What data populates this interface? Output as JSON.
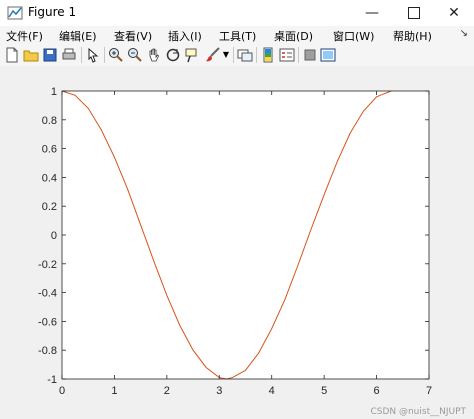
{
  "window": {
    "title": "Figure 1"
  },
  "menu": {
    "items": [
      "文件(F)",
      "编辑(E)",
      "查看(V)",
      "插入(I)",
      "工具(T)",
      "桌面(D)",
      "窗口(W)",
      "帮助(H)"
    ]
  },
  "toolbar": {
    "icons": [
      "new-figure-icon",
      "open-file-icon",
      "save-icon",
      "print-icon",
      "select-arrow-icon",
      "zoom-in-icon",
      "zoom-out-icon",
      "pan-hand-icon",
      "rotate-3d-icon",
      "data-cursor-icon",
      "brush-icon",
      "brush-dropdown-icon",
      "link-plot-icon",
      "colorbar-icon",
      "legend-icon",
      "hide-plot-tools-icon",
      "show-plot-tools-icon"
    ]
  },
  "colors": {
    "line": "#d95319",
    "axes_bg": "#ffffff",
    "figure_bg": "#f0f0f0"
  },
  "chart_data": {
    "type": "line",
    "function": "cos(x)",
    "series": [
      {
        "x": [
          0,
          0.25,
          0.5,
          0.75,
          1,
          1.25,
          1.5,
          1.75,
          2,
          2.25,
          2.5,
          2.75,
          3,
          3.14,
          3.25,
          3.5,
          3.75,
          4,
          4.25,
          4.5,
          4.75,
          5,
          5.25,
          5.5,
          5.75,
          6,
          6.28
        ],
        "y": [
          1,
          0.97,
          0.88,
          0.73,
          0.54,
          0.32,
          0.07,
          -0.18,
          -0.42,
          -0.63,
          -0.8,
          -0.92,
          -0.99,
          -1,
          -0.99,
          -0.94,
          -0.82,
          -0.65,
          -0.45,
          -0.21,
          0.04,
          0.28,
          0.51,
          0.71,
          0.86,
          0.96,
          1
        ]
      }
    ],
    "xlim": [
      0,
      7
    ],
    "ylim": [
      -1,
      1
    ],
    "xticks": [
      "0",
      "1",
      "2",
      "3",
      "4",
      "5",
      "6",
      "7"
    ],
    "yticks": [
      "1",
      "0.8",
      "0.6",
      "0.4",
      "0.2",
      "0",
      "-0.2",
      "-0.4",
      "-0.6",
      "-0.8",
      "-1"
    ],
    "grid": false
  },
  "watermark": "CSDN @nuist__NJUPT"
}
